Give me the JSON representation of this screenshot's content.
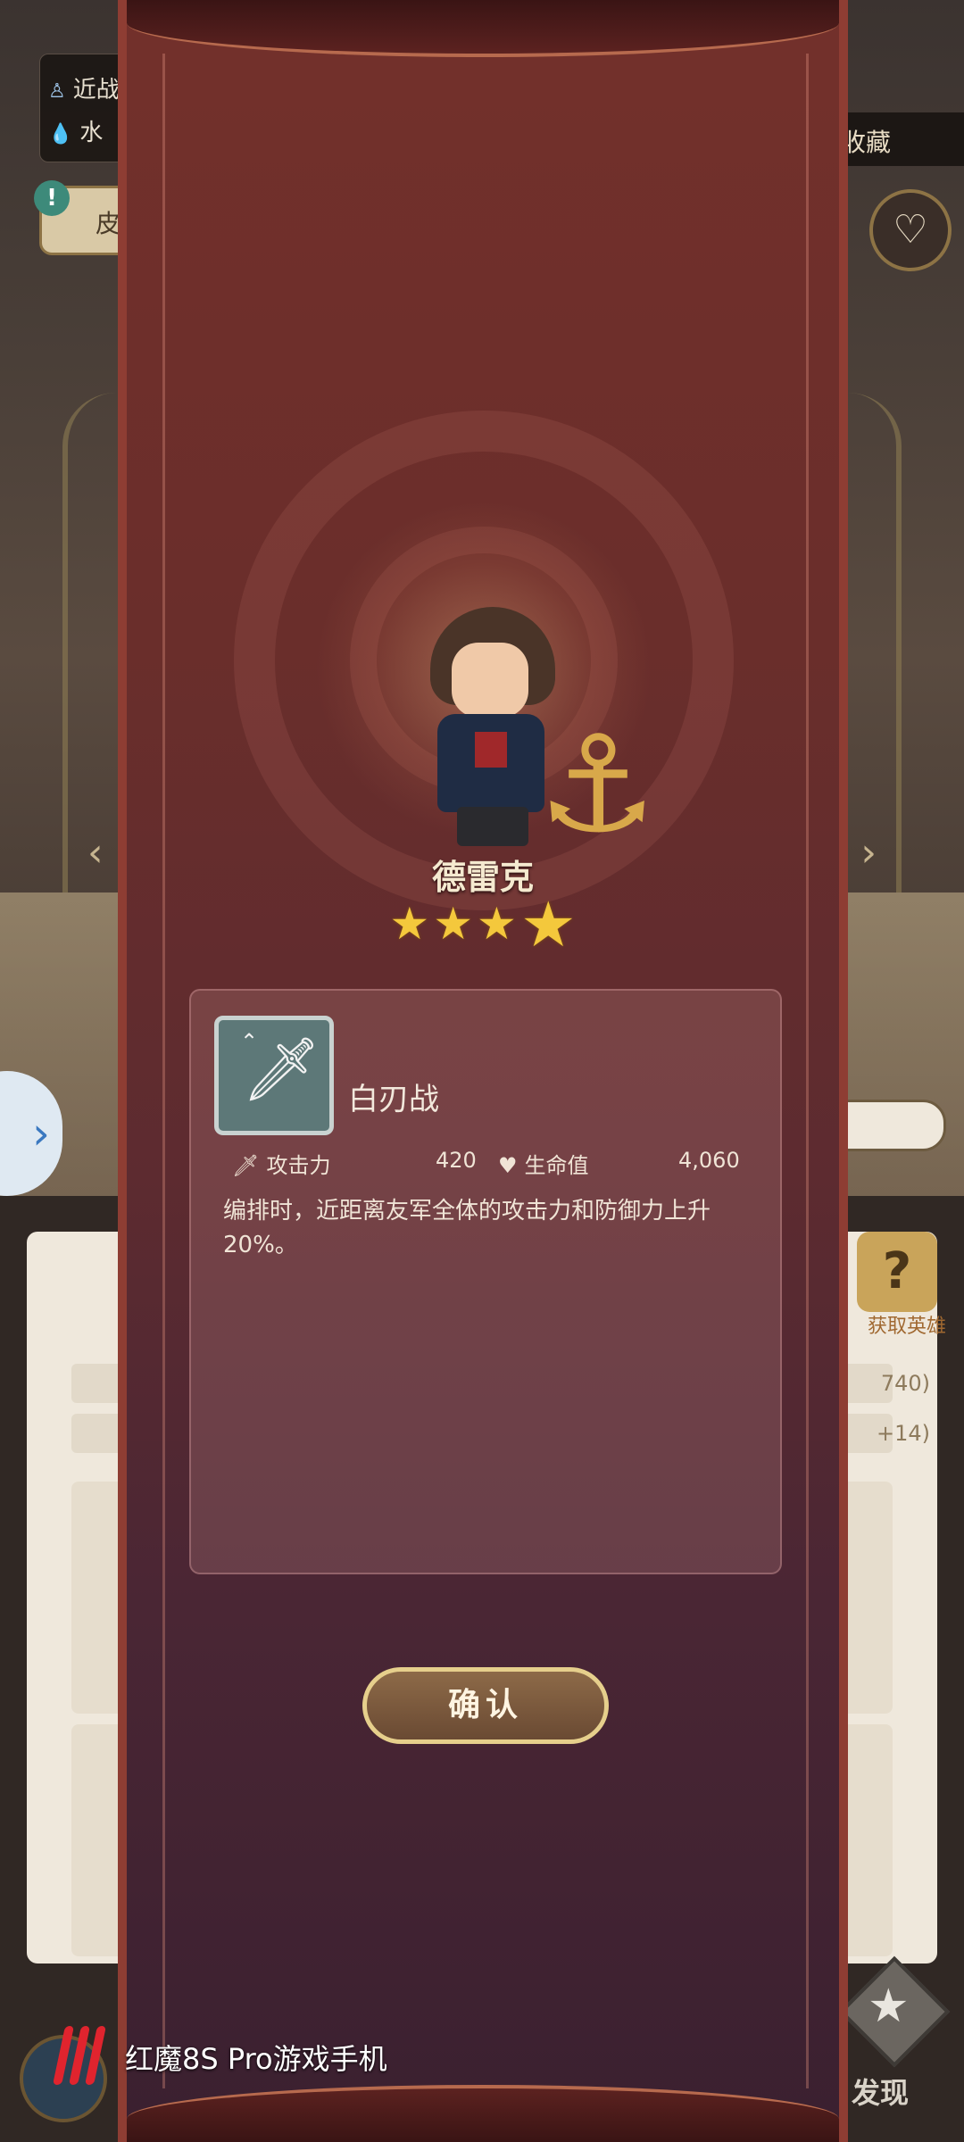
{
  "background": {
    "role_tag": "近战",
    "element_tag": "水",
    "skin_button": "皮",
    "collection_button": "收藏",
    "discover_label": "发现",
    "right_values": [
      "740)",
      "+14)"
    ],
    "mystery_label": "获取英雄"
  },
  "modal": {
    "hero_name": "德雷克",
    "star_count": 4,
    "skill": {
      "name": "白刃战",
      "attack_label": "攻击力",
      "attack_value": "420",
      "hp_label": "生命值",
      "hp_value": "4,060",
      "description": "编排时，近距离友军全体的攻击力和防御力上升20%。"
    },
    "confirm_button": "确认"
  },
  "watermark": {
    "text": "红魔8S Pro游戏手机"
  },
  "colors": {
    "modal_bg": "#6a2e2b",
    "accent_gold": "#e6cf8c",
    "star": "#f4c83c",
    "brand_red": "#e0242e"
  }
}
